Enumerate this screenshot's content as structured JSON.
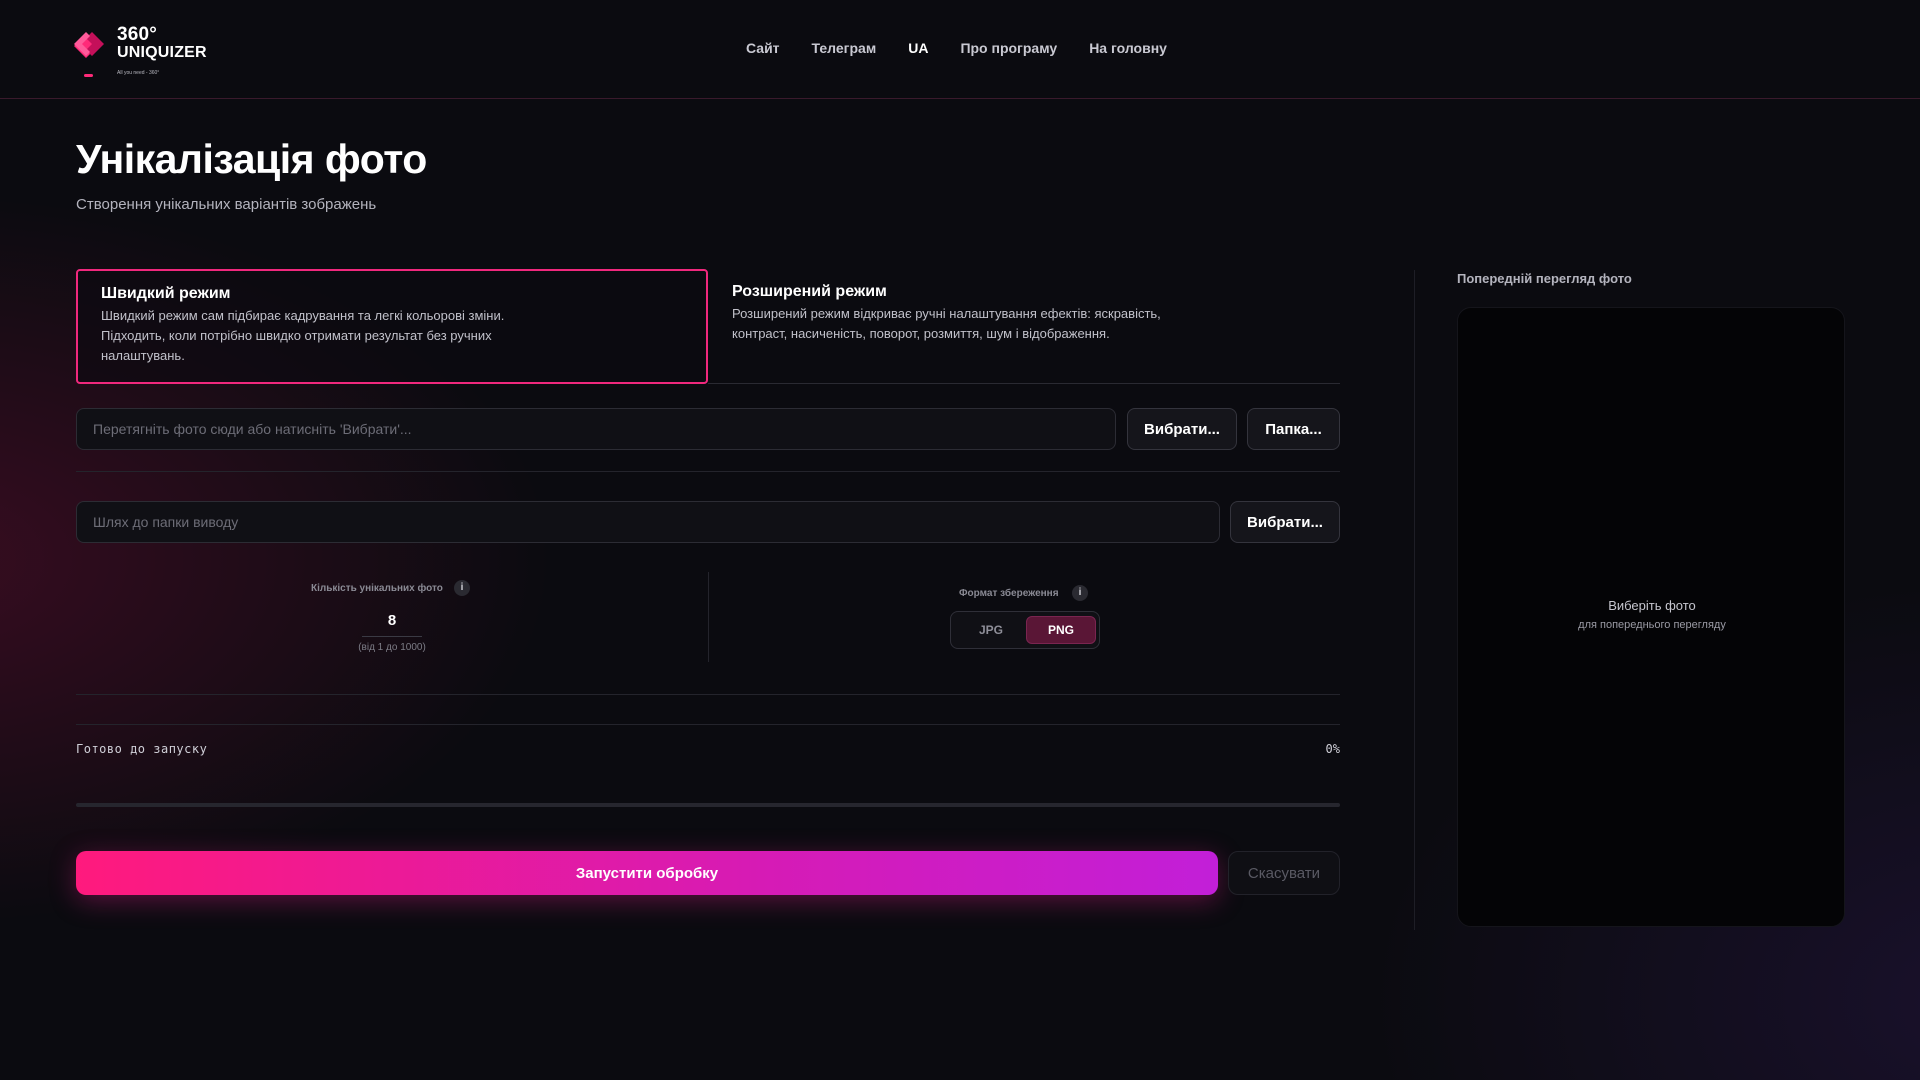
{
  "app": {
    "logo_line1": "360°",
    "logo_line2": "UNIQUIZER",
    "logo_tagline": "All you need - 360°"
  },
  "nav": {
    "items": [
      {
        "label": "Сайт"
      },
      {
        "label": "Телеграм"
      },
      {
        "label": "UA",
        "active": true
      },
      {
        "label": "Про програму"
      },
      {
        "label": "На головну"
      }
    ]
  },
  "page": {
    "title": "Унікалізація фото",
    "subtitle": "Створення унікальних варіантів зображень"
  },
  "modes": {
    "fast": {
      "title": "Швидкий режим",
      "description": "Швидкий режим сам підбирає кадрування та легкі кольорові зміни. Підходить, коли потрібно швидко отримати результат без ручних налаштувань.",
      "selected": true
    },
    "advanced": {
      "title": "Розширений режим",
      "description": "Розширений режим відкриває ручні налаштування ефектів: яскравість, контраст, насиченість, поворот, розмиття, шум і відображення.",
      "selected": false
    }
  },
  "input": {
    "placeholder": "Перетягніть фото сюди або натисніть 'Вибрати'...",
    "choose_label": "Вибрати...",
    "folder_label": "Папка..."
  },
  "output": {
    "placeholder": "Шлях до папки виводу",
    "choose_label": "Вибрати..."
  },
  "settings": {
    "count_label": "Кількість унікальних фото",
    "count_value": "8",
    "count_hint": "(від 1 до 1000)",
    "format_label": "Формат збереження",
    "formats": [
      "JPG",
      "PNG"
    ],
    "selected_format": "PNG",
    "info_icon": "i"
  },
  "status": {
    "text": "Готово до запуску",
    "percent_label": "0%",
    "progress": 0
  },
  "actions": {
    "run_label": "Запустити обробку",
    "cancel_label": "Скасувати"
  },
  "preview": {
    "label": "Попередній перегляд фото",
    "empty_title": "Виберіть фото",
    "empty_subtitle": "для попереднього перегляду"
  },
  "colors": {
    "accent": "#f0287d",
    "accent_gradient_end": "#c21fd8",
    "background": "#0b0b10"
  }
}
